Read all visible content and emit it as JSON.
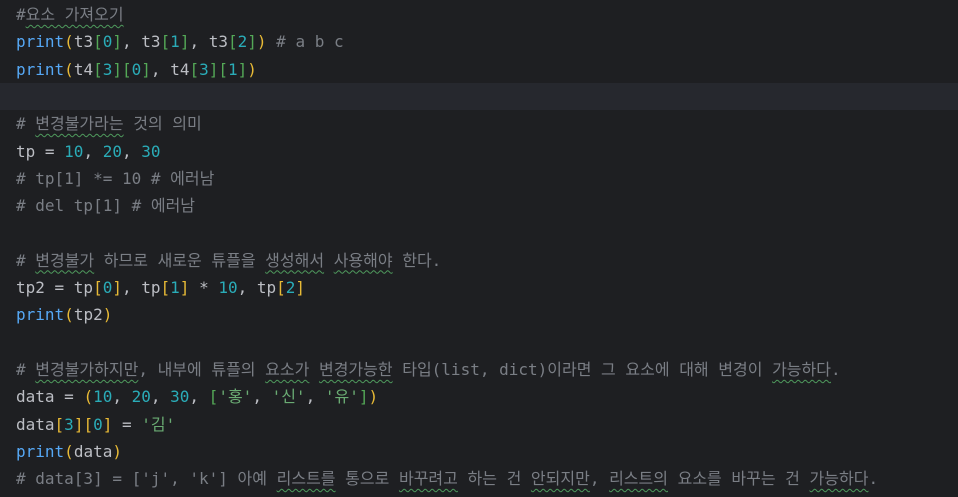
{
  "editor": {
    "lines": [
      {
        "tokens": [
          {
            "text": "#",
            "c": "t-comment"
          },
          {
            "text": "요소 가져오기",
            "c": "t-comment",
            "u": true
          }
        ]
      },
      {
        "tokens": [
          {
            "text": "print",
            "c": "t-func"
          },
          {
            "text": "(",
            "c": "t-b1"
          },
          {
            "text": "t3",
            "c": "t-plain"
          },
          {
            "text": "[",
            "c": "t-b2"
          },
          {
            "text": "0",
            "c": "t-num"
          },
          {
            "text": "]",
            "c": "t-b2"
          },
          {
            "text": ", t3",
            "c": "t-plain"
          },
          {
            "text": "[",
            "c": "t-b2"
          },
          {
            "text": "1",
            "c": "t-num"
          },
          {
            "text": "]",
            "c": "t-b2"
          },
          {
            "text": ", t3",
            "c": "t-plain"
          },
          {
            "text": "[",
            "c": "t-b2"
          },
          {
            "text": "2",
            "c": "t-num"
          },
          {
            "text": "]",
            "c": "t-b2"
          },
          {
            "text": ")",
            "c": "t-b1"
          },
          {
            "text": " # a b c",
            "c": "t-comment"
          }
        ]
      },
      {
        "tokens": [
          {
            "text": "print",
            "c": "t-func"
          },
          {
            "text": "(",
            "c": "t-b1"
          },
          {
            "text": "t4",
            "c": "t-plain"
          },
          {
            "text": "[",
            "c": "t-b2"
          },
          {
            "text": "3",
            "c": "t-num"
          },
          {
            "text": "]",
            "c": "t-b2"
          },
          {
            "text": "[",
            "c": "t-b2"
          },
          {
            "text": "0",
            "c": "t-num"
          },
          {
            "text": "]",
            "c": "t-b2"
          },
          {
            "text": ", t4",
            "c": "t-plain"
          },
          {
            "text": "[",
            "c": "t-b2"
          },
          {
            "text": "3",
            "c": "t-num"
          },
          {
            "text": "]",
            "c": "t-b2"
          },
          {
            "text": "[",
            "c": "t-b2"
          },
          {
            "text": "1",
            "c": "t-num"
          },
          {
            "text": "]",
            "c": "t-b2"
          },
          {
            "text": ")",
            "c": "t-b1"
          }
        ]
      },
      {
        "current": true,
        "tokens": []
      },
      {
        "tokens": [
          {
            "text": "# ",
            "c": "t-comment"
          },
          {
            "text": "변경불가라는",
            "c": "t-comment",
            "u": true
          },
          {
            "text": " 것의 의미",
            "c": "t-comment"
          }
        ]
      },
      {
        "tokens": [
          {
            "text": "tp = ",
            "c": "t-plain"
          },
          {
            "text": "10",
            "c": "t-num"
          },
          {
            "text": ", ",
            "c": "t-plain"
          },
          {
            "text": "20",
            "c": "t-num"
          },
          {
            "text": ", ",
            "c": "t-plain"
          },
          {
            "text": "30",
            "c": "t-num"
          }
        ]
      },
      {
        "tokens": [
          {
            "text": "# tp[1] *= 10 # 에러남",
            "c": "t-comment"
          }
        ]
      },
      {
        "tokens": [
          {
            "text": "# del tp[1] # 에러남",
            "c": "t-comment"
          }
        ]
      },
      {
        "tokens": []
      },
      {
        "tokens": [
          {
            "text": "# ",
            "c": "t-comment"
          },
          {
            "text": "변경불가",
            "c": "t-comment",
            "u": true
          },
          {
            "text": " 하므로 새로운 튜플을 ",
            "c": "t-comment"
          },
          {
            "text": "생성해서",
            "c": "t-comment",
            "u": true
          },
          {
            "text": " ",
            "c": "t-comment"
          },
          {
            "text": "사용해야",
            "c": "t-comment",
            "u": true
          },
          {
            "text": " 한다.",
            "c": "t-comment"
          }
        ]
      },
      {
        "tokens": [
          {
            "text": "tp2 = tp",
            "c": "t-plain"
          },
          {
            "text": "[",
            "c": "t-b1"
          },
          {
            "text": "0",
            "c": "t-num"
          },
          {
            "text": "]",
            "c": "t-b1"
          },
          {
            "text": ", tp",
            "c": "t-plain"
          },
          {
            "text": "[",
            "c": "t-b1"
          },
          {
            "text": "1",
            "c": "t-num"
          },
          {
            "text": "]",
            "c": "t-b1"
          },
          {
            "text": " * ",
            "c": "t-plain"
          },
          {
            "text": "10",
            "c": "t-num"
          },
          {
            "text": ", tp",
            "c": "t-plain"
          },
          {
            "text": "[",
            "c": "t-b1"
          },
          {
            "text": "2",
            "c": "t-num"
          },
          {
            "text": "]",
            "c": "t-b1"
          }
        ]
      },
      {
        "tokens": [
          {
            "text": "print",
            "c": "t-func"
          },
          {
            "text": "(",
            "c": "t-b1"
          },
          {
            "text": "tp2",
            "c": "t-plain"
          },
          {
            "text": ")",
            "c": "t-b1"
          }
        ]
      },
      {
        "tokens": []
      },
      {
        "tokens": [
          {
            "text": "# ",
            "c": "t-comment"
          },
          {
            "text": "변경불가하지만",
            "c": "t-comment",
            "u": true
          },
          {
            "text": ", 내부에 튜플의 ",
            "c": "t-comment"
          },
          {
            "text": "요소가",
            "c": "t-comment",
            "u": true
          },
          {
            "text": " ",
            "c": "t-comment"
          },
          {
            "text": "변경가능한",
            "c": "t-comment",
            "u": true
          },
          {
            "text": " 타입(list, dict)이라면 그 요소에 대해 변경이 ",
            "c": "t-comment"
          },
          {
            "text": "가능하다",
            "c": "t-comment",
            "u": true
          },
          {
            "text": ".",
            "c": "t-comment"
          }
        ]
      },
      {
        "tokens": [
          {
            "text": "data = ",
            "c": "t-plain"
          },
          {
            "text": "(",
            "c": "t-b1"
          },
          {
            "text": "10",
            "c": "t-num"
          },
          {
            "text": ", ",
            "c": "t-plain"
          },
          {
            "text": "20",
            "c": "t-num"
          },
          {
            "text": ", ",
            "c": "t-plain"
          },
          {
            "text": "30",
            "c": "t-num"
          },
          {
            "text": ", ",
            "c": "t-plain"
          },
          {
            "text": "[",
            "c": "t-b2"
          },
          {
            "text": "'홍'",
            "c": "t-str"
          },
          {
            "text": ", ",
            "c": "t-plain"
          },
          {
            "text": "'신'",
            "c": "t-str"
          },
          {
            "text": ", ",
            "c": "t-plain"
          },
          {
            "text": "'유'",
            "c": "t-str"
          },
          {
            "text": "]",
            "c": "t-b2"
          },
          {
            "text": ")",
            "c": "t-b1"
          }
        ]
      },
      {
        "tokens": [
          {
            "text": "data",
            "c": "t-plain"
          },
          {
            "text": "[",
            "c": "t-b1"
          },
          {
            "text": "3",
            "c": "t-num"
          },
          {
            "text": "]",
            "c": "t-b1"
          },
          {
            "text": "[",
            "c": "t-b1"
          },
          {
            "text": "0",
            "c": "t-num"
          },
          {
            "text": "]",
            "c": "t-b1"
          },
          {
            "text": " = ",
            "c": "t-plain"
          },
          {
            "text": "'김'",
            "c": "t-str"
          }
        ]
      },
      {
        "tokens": [
          {
            "text": "print",
            "c": "t-func"
          },
          {
            "text": "(",
            "c": "t-b1"
          },
          {
            "text": "data",
            "c": "t-plain"
          },
          {
            "text": ")",
            "c": "t-b1"
          }
        ]
      },
      {
        "tokens": [
          {
            "text": "# data[3] = ['j', 'k'] 아예 ",
            "c": "t-comment"
          },
          {
            "text": "리스트를",
            "c": "t-comment",
            "u": true
          },
          {
            "text": " 통으로 ",
            "c": "t-comment"
          },
          {
            "text": "바꾸려고",
            "c": "t-comment",
            "u": true
          },
          {
            "text": " 하는 건 ",
            "c": "t-comment"
          },
          {
            "text": "안되지만",
            "c": "t-comment",
            "u": true
          },
          {
            "text": ", ",
            "c": "t-comment"
          },
          {
            "text": "리스트의",
            "c": "t-comment",
            "u": true
          },
          {
            "text": " 요소를 바꾸는 건 ",
            "c": "t-comment"
          },
          {
            "text": "가능하다",
            "c": "t-comment",
            "u": true
          },
          {
            "text": ".",
            "c": "t-comment"
          }
        ]
      }
    ]
  }
}
